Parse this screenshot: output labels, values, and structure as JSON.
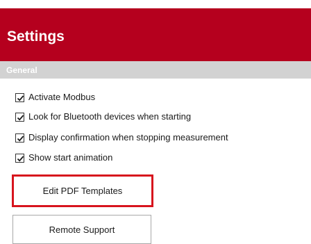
{
  "header": {
    "title": "Settings"
  },
  "section": {
    "label": "General"
  },
  "options": [
    {
      "label": "Activate Modbus",
      "checked": true
    },
    {
      "label": "Look for Bluetooth devices when starting",
      "checked": true
    },
    {
      "label": "Display confirmation when stopping measurement",
      "checked": true
    },
    {
      "label": "Show start animation",
      "checked": true
    }
  ],
  "buttons": {
    "edit_pdf_templates": "Edit PDF Templates",
    "remote_support": "Remote Support"
  },
  "colors": {
    "header_background": "#b5001e",
    "section_background": "#d2d2d2",
    "focus_border": "#d7141d"
  }
}
